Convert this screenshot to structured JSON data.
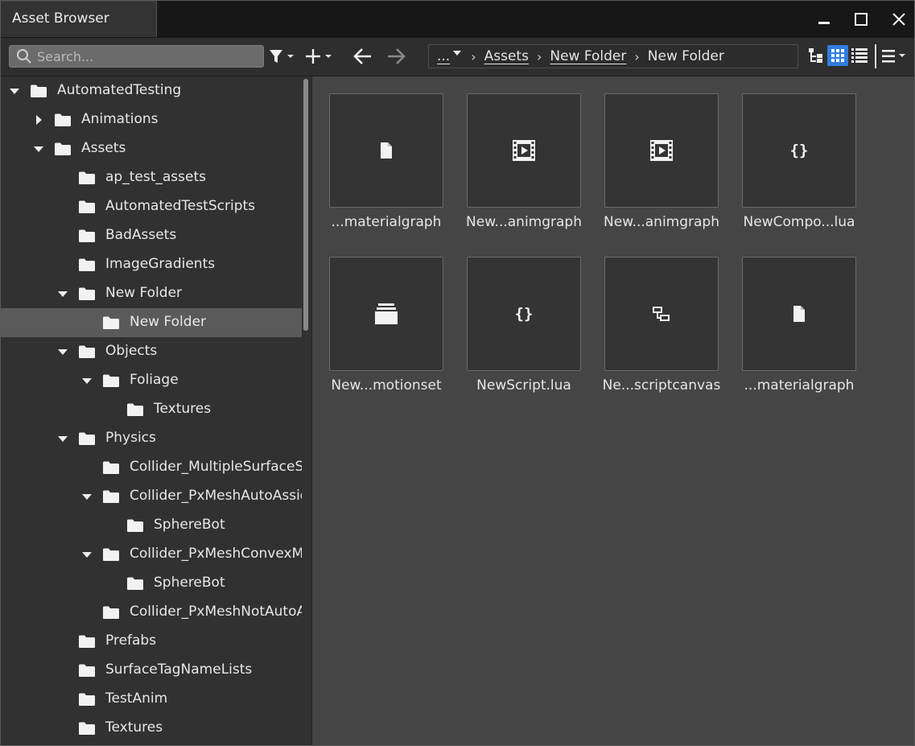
{
  "window": {
    "title": "Asset Browser"
  },
  "toolbar": {
    "search_placeholder": "Search...",
    "breadcrumb": {
      "overflow": "...",
      "items": [
        "Assets",
        "New Folder",
        "New Folder"
      ],
      "separator": "›"
    }
  },
  "tree": [
    {
      "label": "AutomatedTesting",
      "arrow": "down"
    },
    {
      "label": "Animations",
      "arrow": "right"
    },
    {
      "label": "Assets",
      "arrow": "down"
    },
    {
      "label": "ap_test_assets",
      "arrow": ""
    },
    {
      "label": "AutomatedTestScripts",
      "arrow": ""
    },
    {
      "label": "BadAssets",
      "arrow": ""
    },
    {
      "label": "ImageGradients",
      "arrow": ""
    },
    {
      "label": "New Folder",
      "arrow": "down"
    },
    {
      "label": "New Folder",
      "arrow": "",
      "selected": true
    },
    {
      "label": "Objects",
      "arrow": "down"
    },
    {
      "label": "Foliage",
      "arrow": "down"
    },
    {
      "label": "Textures",
      "arrow": ""
    },
    {
      "label": "Physics",
      "arrow": "down"
    },
    {
      "label": "Collider_MultipleSurfaceS",
      "arrow": ""
    },
    {
      "label": "Collider_PxMeshAutoAssig",
      "arrow": "down"
    },
    {
      "label": "SphereBot",
      "arrow": ""
    },
    {
      "label": "Collider_PxMeshConvexM",
      "arrow": "down"
    },
    {
      "label": "SphereBot",
      "arrow": ""
    },
    {
      "label": "Collider_PxMeshNotAutoA",
      "arrow": ""
    },
    {
      "label": "Prefabs",
      "arrow": ""
    },
    {
      "label": "SurfaceTagNameLists",
      "arrow": ""
    },
    {
      "label": "TestAnim",
      "arrow": ""
    },
    {
      "label": "Textures",
      "arrow": ""
    }
  ],
  "assets": [
    {
      "label": "...materialgraph",
      "icon": "file-icon"
    },
    {
      "label": "New...animgraph",
      "icon": "film-icon"
    },
    {
      "label": "New...animgraph",
      "icon": "film-icon"
    },
    {
      "label": "NewCompo...lua",
      "icon": "braces-icon"
    },
    {
      "label": "New...motionset",
      "icon": "motionset-icon"
    },
    {
      "label": "NewScript.lua",
      "icon": "braces-icon"
    },
    {
      "label": "Ne...scriptcanvas",
      "icon": "scriptcanvas-icon"
    },
    {
      "label": "...materialgraph",
      "icon": "file-icon"
    }
  ],
  "colors": {
    "accent": "#2f7de0",
    "selection": "#5a5a5a",
    "grid_bg": "#454545",
    "tree_bg": "#313131"
  }
}
